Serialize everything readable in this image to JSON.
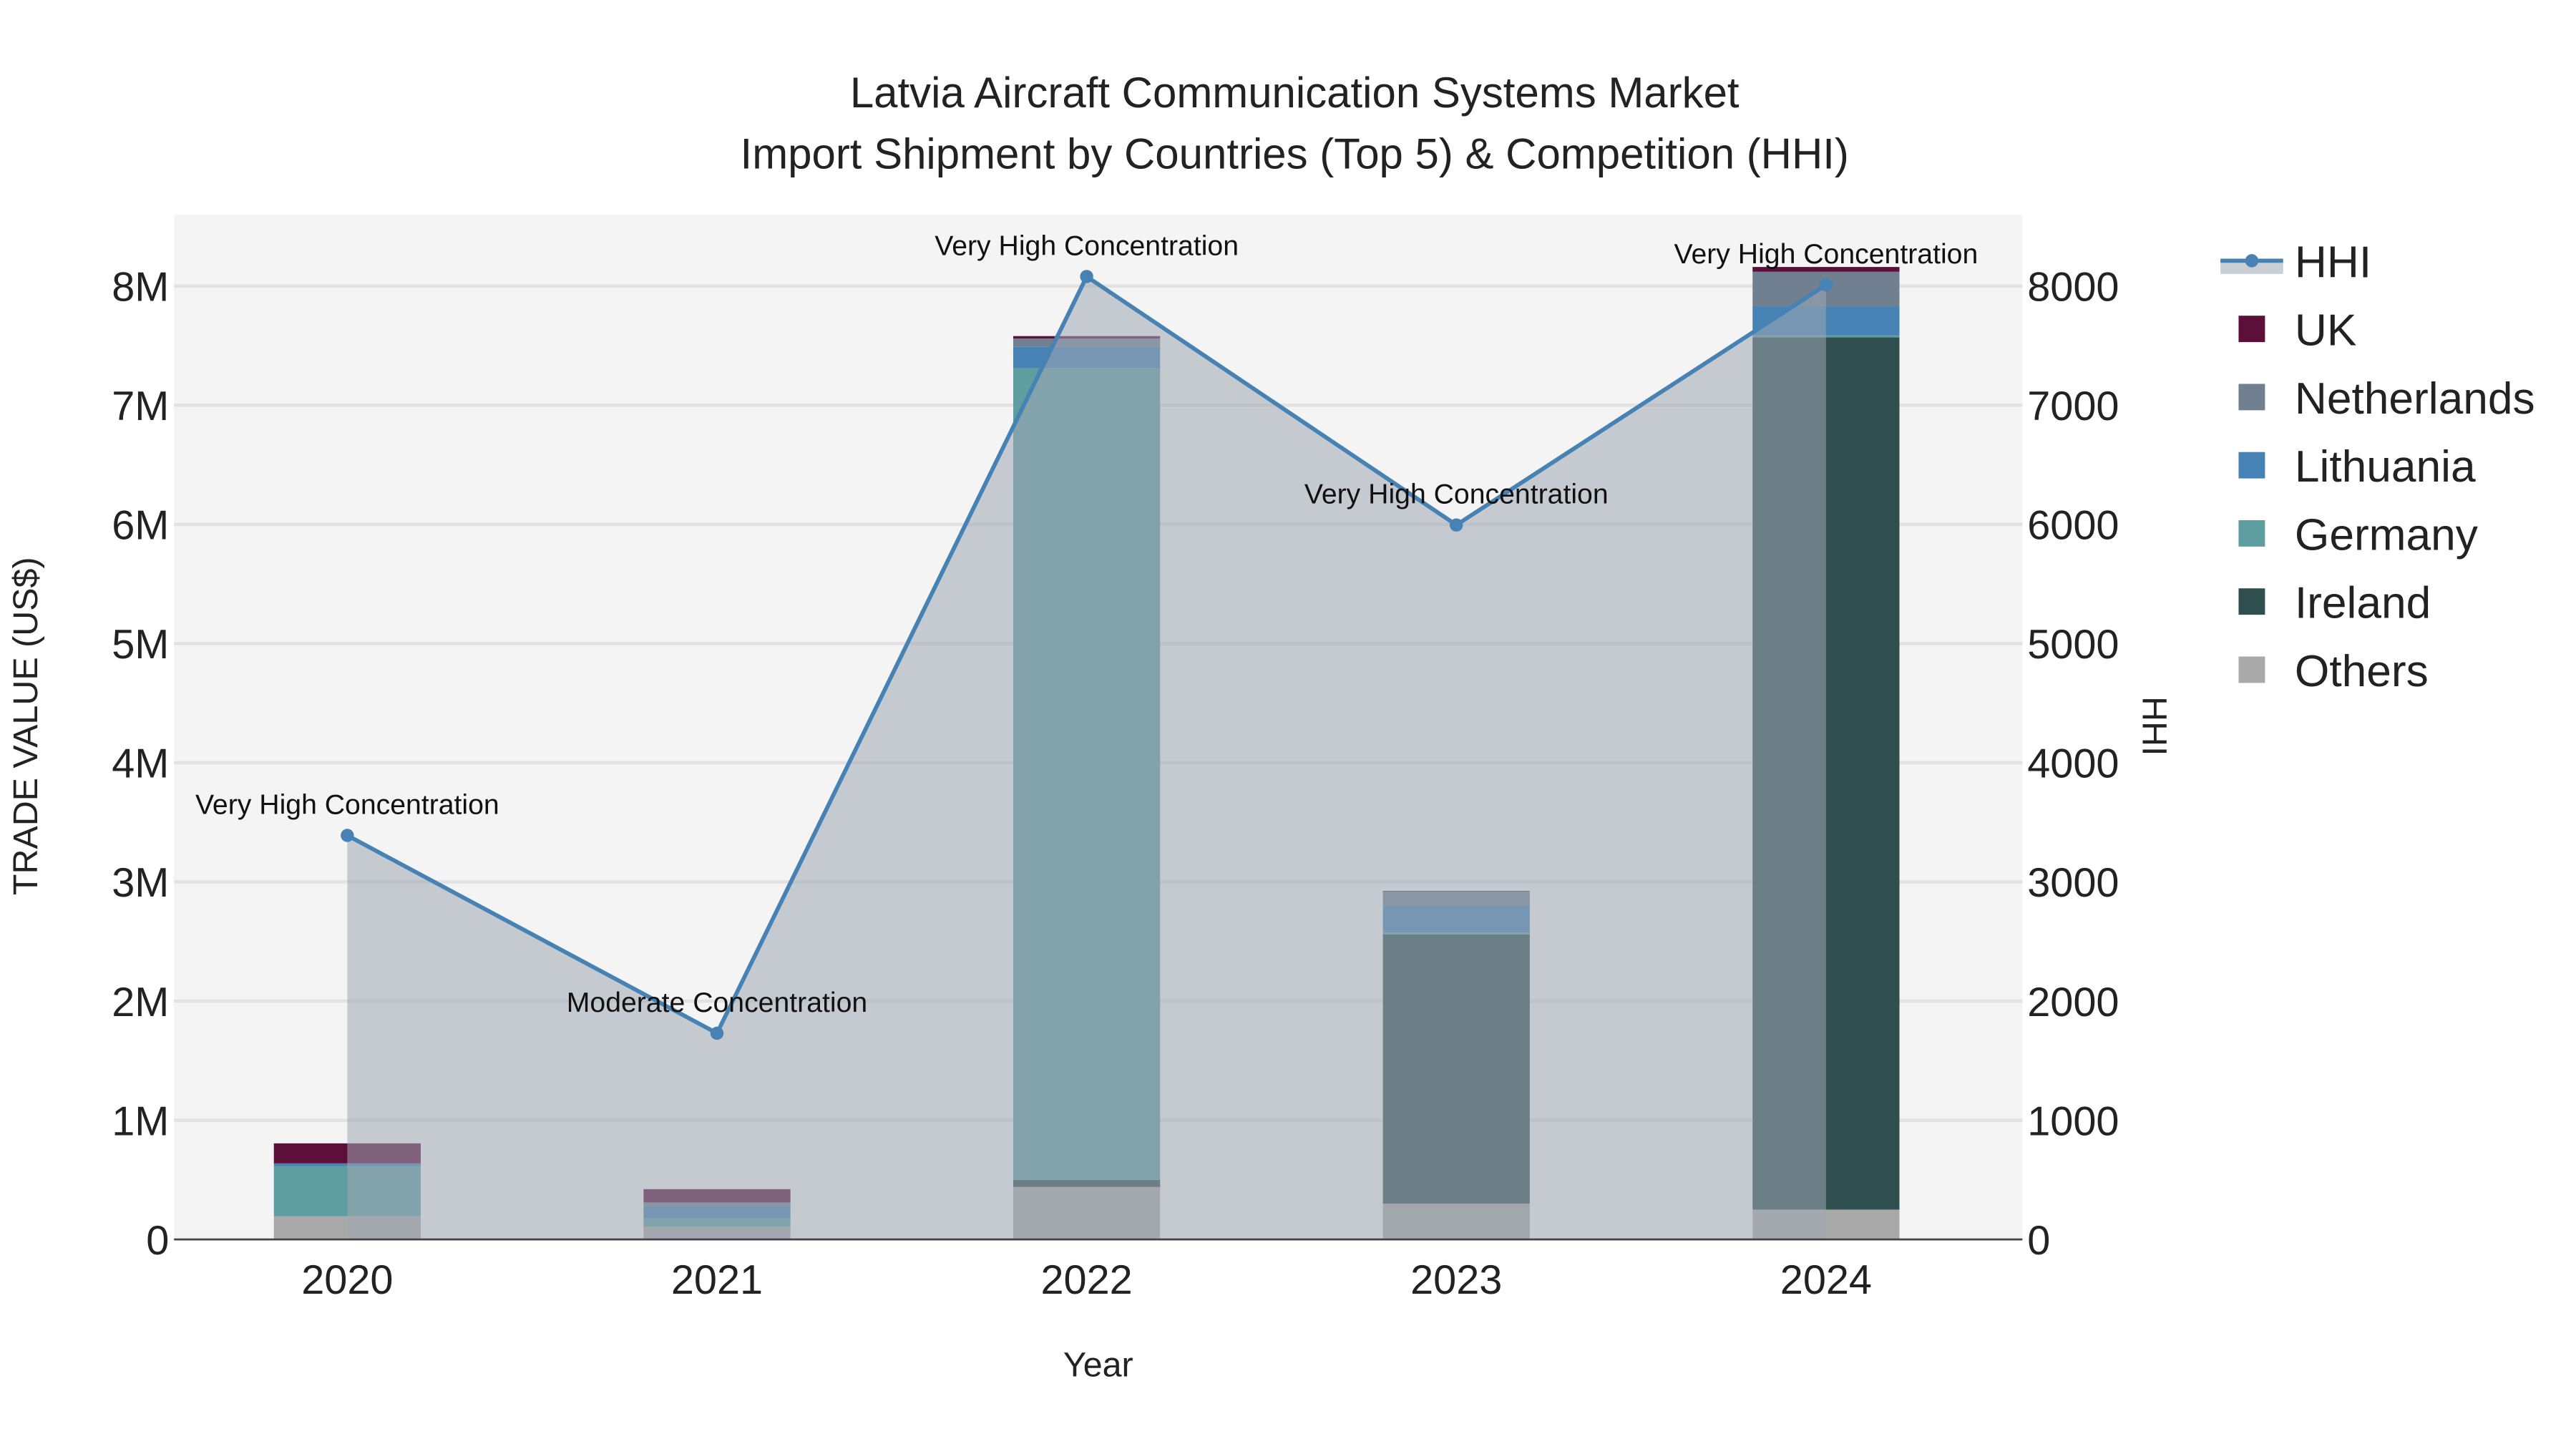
{
  "chart_data": {
    "type": "bar",
    "title_line1": "Latvia Aircraft Communication Systems Market",
    "title_line2": "Import Shipment by Countries (Top 5) & Competition (HHI)",
    "xlabel": "Year",
    "ylabel": "TRADE VALUE (US$)",
    "y2label": "HHI",
    "categories": [
      "2020",
      "2021",
      "2022",
      "2023",
      "2024"
    ],
    "ylim": [
      0,
      8600000
    ],
    "y2lim": [
      0,
      8600
    ],
    "yticks": [
      0,
      1000000,
      2000000,
      3000000,
      4000000,
      5000000,
      6000000,
      7000000,
      8000000
    ],
    "ytick_labels": [
      "0",
      "1M",
      "2M",
      "3M",
      "4M",
      "5M",
      "6M",
      "7M",
      "8M"
    ],
    "y2ticks": [
      0,
      1000,
      2000,
      3000,
      4000,
      5000,
      6000,
      7000,
      8000
    ],
    "y2tick_labels": [
      "0",
      "1000",
      "2000",
      "3000",
      "4000",
      "5000",
      "6000",
      "7000",
      "8000"
    ],
    "grid": true,
    "legend_position": "right",
    "series": [
      {
        "name": "Others",
        "color": "#a9a9a9",
        "values": [
          194000,
          106000,
          440000,
          300000,
          250000
        ]
      },
      {
        "name": "Ireland",
        "color": "#2f4f4f",
        "values": [
          0,
          0,
          60000,
          2260000,
          7320000
        ]
      },
      {
        "name": "Germany",
        "color": "#5f9ea0",
        "values": [
          420000,
          72000,
          6810000,
          15000,
          15000
        ]
      },
      {
        "name": "Lithuania",
        "color": "#4682b4",
        "values": [
          24000,
          96000,
          180000,
          225000,
          245000
        ]
      },
      {
        "name": "Netherlands",
        "color": "#708090",
        "values": [
          0,
          36000,
          70000,
          120000,
          290000
        ]
      },
      {
        "name": "UK",
        "color": "#5c0f38",
        "values": [
          168000,
          112000,
          20000,
          5000,
          40000
        ]
      }
    ],
    "hhi": {
      "name": "HHI",
      "color": "#4682b4",
      "values": [
        3390,
        1730,
        8080,
        5995,
        8010
      ],
      "annotations": [
        "Very High Concentration",
        "Moderate Concentration",
        "Very High Concentration",
        "Very High Concentration",
        "Very High Concentration"
      ]
    },
    "legend_order": [
      "HHI",
      "UK",
      "Netherlands",
      "Lithuania",
      "Germany",
      "Ireland",
      "Others"
    ]
  }
}
